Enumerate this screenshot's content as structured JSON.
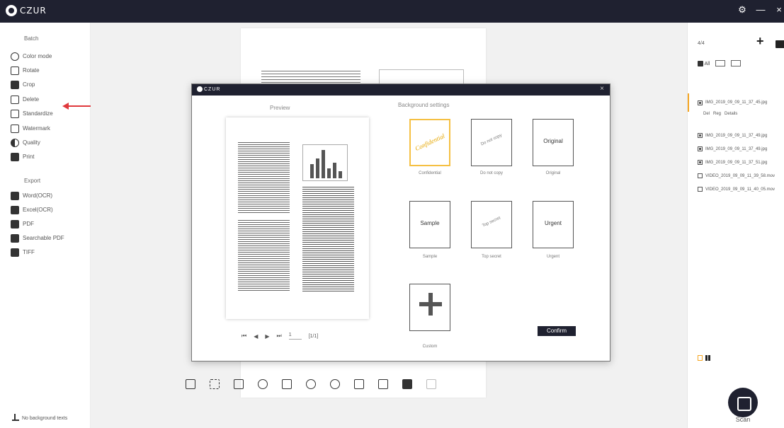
{
  "app": {
    "title": "CZUR"
  },
  "sidebar": {
    "batch_title": "Batch",
    "items": [
      {
        "label": "Color mode",
        "icon": "palette-icon"
      },
      {
        "label": "Rotate",
        "icon": "rotate-icon"
      },
      {
        "label": "Crop",
        "icon": "crop-icon"
      },
      {
        "label": "Delete",
        "icon": "delete-icon"
      },
      {
        "label": "Standardize",
        "icon": "standardize-icon"
      },
      {
        "label": "Watermark",
        "icon": "watermark-icon"
      },
      {
        "label": "Quality",
        "icon": "quality-icon"
      },
      {
        "label": "Print",
        "icon": "print-icon"
      }
    ],
    "export_title": "Export",
    "export_items": [
      {
        "label": "Word(OCR)",
        "icon": "word-icon"
      },
      {
        "label": "Excel(OCR)",
        "icon": "excel-icon"
      },
      {
        "label": "PDF",
        "icon": "pdf-icon"
      },
      {
        "label": "Searchable PDF",
        "icon": "searchable-pdf-icon"
      },
      {
        "label": "TIFF",
        "icon": "tiff-icon"
      }
    ],
    "footer_label": "No background texts"
  },
  "modal": {
    "title": "CZUR",
    "preview_title": "Preview",
    "settings_title": "Background settings",
    "cards": [
      {
        "text": "Confidential",
        "label": "Confidential",
        "selected": true
      },
      {
        "text": "Do not copy",
        "label": "Do not copy"
      },
      {
        "text": "Original",
        "label": "Original"
      },
      {
        "text": "Sample",
        "label": "Sample"
      },
      {
        "text": "Top secret",
        "label": "Top secret"
      },
      {
        "text": "Urgent",
        "label": "Urgent"
      },
      {
        "text": "",
        "label": "Custom"
      }
    ],
    "pager": {
      "first": "⏮",
      "prev": "◀",
      "next": "▶",
      "last": "⏭",
      "current": "1",
      "total": "[1/1]"
    },
    "confirm_label": "Confirm",
    "close_label": "×"
  },
  "right_panel": {
    "count": "4/4",
    "filter_all": "All",
    "files": [
      {
        "name": "IMG_2019_09_09_11_37_45.jpg",
        "checked": true,
        "active": true
      },
      {
        "name": "IMG_2019_09_09_11_37_49.jpg",
        "checked": true
      },
      {
        "name": "IMG_2019_09_09_11_37_49.jpg",
        "checked": true
      },
      {
        "name": "IMG_2019_09_09_11_37_51.jpg",
        "checked": true
      },
      {
        "name": "VIDEO_2019_09_09_11_39_58.mov",
        "checked": false
      },
      {
        "name": "VIDEO_2019_09_09_11_40_05.mov",
        "checked": false
      }
    ],
    "file_actions": [
      "Del",
      "Reg",
      "Details"
    ],
    "scan_label": "Scan"
  },
  "colors": {
    "titlebar": "#1f2130",
    "accent": "#f5a623",
    "arrow": "#e0393d"
  }
}
